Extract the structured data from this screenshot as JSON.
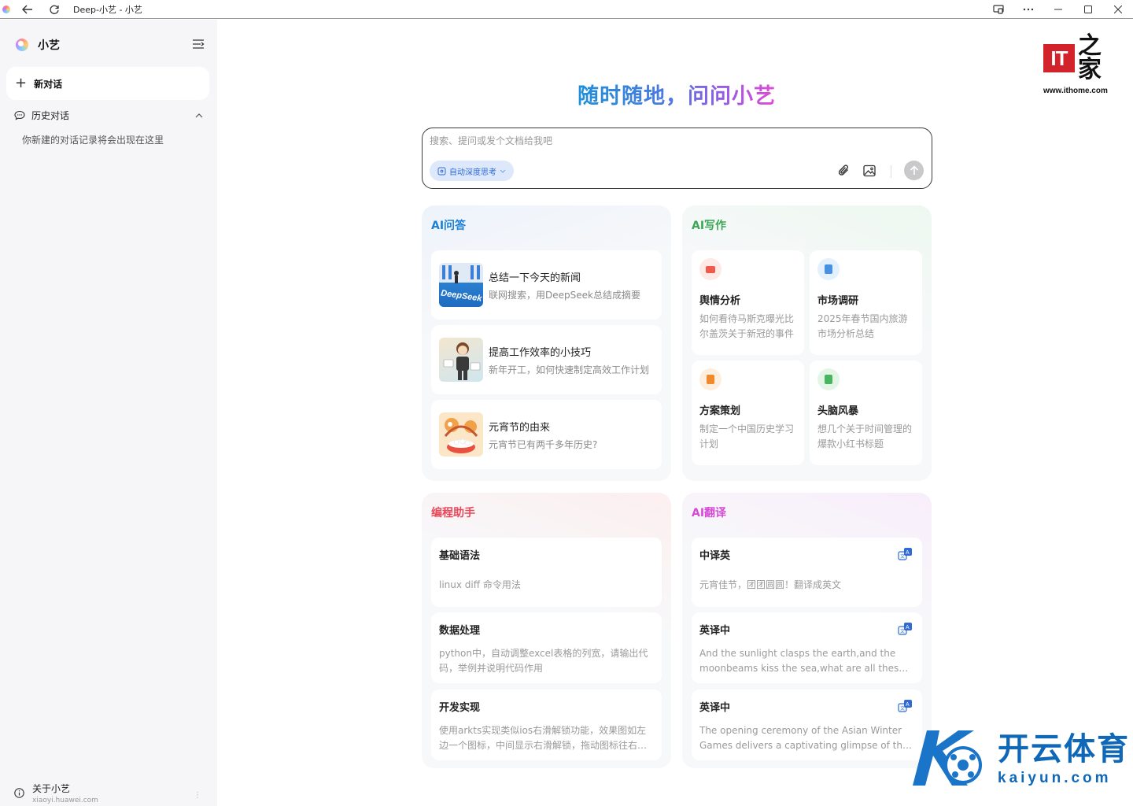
{
  "window": {
    "title": "Deep-小艺 - 小艺"
  },
  "sidebar": {
    "app_name": "小艺",
    "new_chat_label": "新对话",
    "history_label": "历史对话",
    "history_empty_text": "你新建的对话记录将会出现在这里",
    "about_label": "关于小艺",
    "about_url": "xiaoyi.huawei.com"
  },
  "main": {
    "hero_title": "随时随地，问问小艺",
    "search": {
      "placeholder": "搜索、提问或发个文档给我吧",
      "deep_think_label": "自动深度思考"
    },
    "ai_qa": {
      "title": "AI问答",
      "items": [
        {
          "title": "总结一下今天的新闻",
          "subtitle": "联网搜索，用DeepSeek总结成摘要"
        },
        {
          "title": "提高工作效率的小技巧",
          "subtitle": "新年开工，如何快速制定高效工作计划"
        },
        {
          "title": "元宵节的由来",
          "subtitle": "元宵节已有两千多年历史?"
        }
      ]
    },
    "ai_writing": {
      "title": "AI写作",
      "items": [
        {
          "title": "舆情分析",
          "desc": "如何看待马斯克曝光比尔盖茨关于新冠的事件"
        },
        {
          "title": "市场调研",
          "desc": "2025年春节国内旅游市场分析总结"
        },
        {
          "title": "方案策划",
          "desc": "制定一个中国历史学习计划"
        },
        {
          "title": "头脑风暴",
          "desc": "想几个关于时间管理的爆款小红书标题"
        }
      ]
    },
    "coding": {
      "title": "编程助手",
      "items": [
        {
          "title": "基础语法",
          "desc": "linux diff 命令用法"
        },
        {
          "title": "数据处理",
          "desc": "python中，自动调整excel表格的列宽，请输出代码，举例并说明代码作用"
        },
        {
          "title": "开发实现",
          "desc": "使用arkts实现类似ios右滑解锁功能，效果图如左边一个图标，中间显示右滑解锁，拖动图标往右滑动解锁"
        }
      ]
    },
    "translation": {
      "title": "AI翻译",
      "items": [
        {
          "title": "中译英",
          "desc": "元宵佳节，团团圆圆！翻译成英文"
        },
        {
          "title": "英译中",
          "desc": "And the sunlight clasps the earth,and the moonbeams kiss the sea,what are all these kissings worth"
        },
        {
          "title": "英译中",
          "desc": "The opening ceremony of the Asian Winter Games delivers a captivating glimpse of the host city's culture"
        }
      ]
    }
  },
  "watermarks": {
    "ithome_logo": "IT之家",
    "ithome_url": "www.ithome.com",
    "kaiyun_cn": "开云体育",
    "kaiyun_en": "kaiyun.com"
  },
  "colors": {
    "qa_title": "#1a7fd6",
    "writing_title": "#3aa655",
    "coding_title": "#e8485a",
    "translation_title": "#d44bd6",
    "accent_blue": "#2f6ad6"
  },
  "icons": {
    "back": "back-arrow-icon",
    "refresh": "refresh-icon",
    "cast": "cast-icon",
    "more": "more-icon",
    "minimize": "minimize-icon",
    "maximize": "maximize-icon",
    "close": "close-icon",
    "sidebar_toggle": "sidebar-toggle-icon",
    "chat": "chat-bubble-icon",
    "attach": "paperclip-icon",
    "image": "image-icon",
    "send": "send-arrow-icon",
    "translate": "translate-icon",
    "info": "info-icon"
  }
}
